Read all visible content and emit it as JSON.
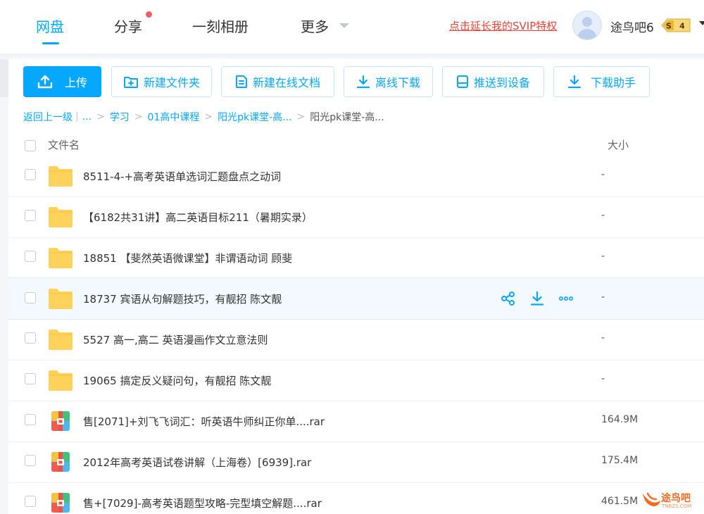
{
  "nav": {
    "tabs": [
      {
        "label": "网盘",
        "active": true
      },
      {
        "label": "分享",
        "has_red_dot": true
      },
      {
        "label": "一刻相册"
      },
      {
        "label": "更多",
        "has_caret": true
      }
    ],
    "svip_link": "点击延长我的SVIP特权",
    "username": "途鸟吧6",
    "vip_badge": {
      "prefix": "S",
      "level": "4"
    }
  },
  "toolbar": [
    {
      "label": "上传",
      "icon": "upload-icon",
      "primary": true
    },
    {
      "label": "新建文件夹",
      "icon": "new-folder-icon"
    },
    {
      "label": "新建在线文档",
      "icon": "online-doc-icon"
    },
    {
      "label": "离线下载",
      "icon": "offline-download-icon"
    },
    {
      "label": "推送到设备",
      "icon": "device-icon"
    },
    {
      "label": "下载助手",
      "icon": "download-helper-icon"
    }
  ],
  "breadcrumb": {
    "back": "返回上一级",
    "divider": "|",
    "ellipsis": "...",
    "items": [
      "学习",
      "01高中课程",
      "阳光pk课堂-高..."
    ],
    "current": "阳光pk课堂-高...",
    "separator": ">"
  },
  "table": {
    "col_name": "文件名",
    "col_size": "大小"
  },
  "files": [
    {
      "name": "8511-4-+高考英语单选词汇题盘点之动词",
      "size": "-",
      "type": "folder"
    },
    {
      "name": "【6182共31讲】高二英语目标211（暑期实录）",
      "size": "-",
      "type": "folder"
    },
    {
      "name": "18851 【斐然英语微课堂】非谓语动词 顾斐",
      "size": "-",
      "type": "folder"
    },
    {
      "name": "18737 宾语从句解题技巧，有靓招 陈文靓",
      "size": "-",
      "type": "folder",
      "hover": true
    },
    {
      "name": "5527 高一,高二 英语漫画作文立意法则",
      "size": "-",
      "type": "folder"
    },
    {
      "name": "19065 搞定反义疑问句，有靓招 陈文靓",
      "size": "-",
      "type": "folder"
    },
    {
      "name": "售[2071]+刘飞飞词汇：听英语牛师纠正你单....rar",
      "size": "164.9M",
      "type": "rar"
    },
    {
      "name": "2012年高考英语试卷讲解（上海卷）[6939].rar",
      "size": "175.4M",
      "type": "rar"
    },
    {
      "name": "售+[7029]-高考英语题型攻略-完型填空解题....rar",
      "size": "461.5M",
      "type": "rar"
    }
  ],
  "row_actions": [
    "share-icon",
    "download-icon",
    "more-icon"
  ],
  "watermark": {
    "text": "途鸟吧",
    "sub": "TNBZS.COM"
  },
  "colors": {
    "accent": "#06a7ff",
    "svip": "#e8443a",
    "folder": "#ffd35b",
    "badge": "#e8b535"
  }
}
